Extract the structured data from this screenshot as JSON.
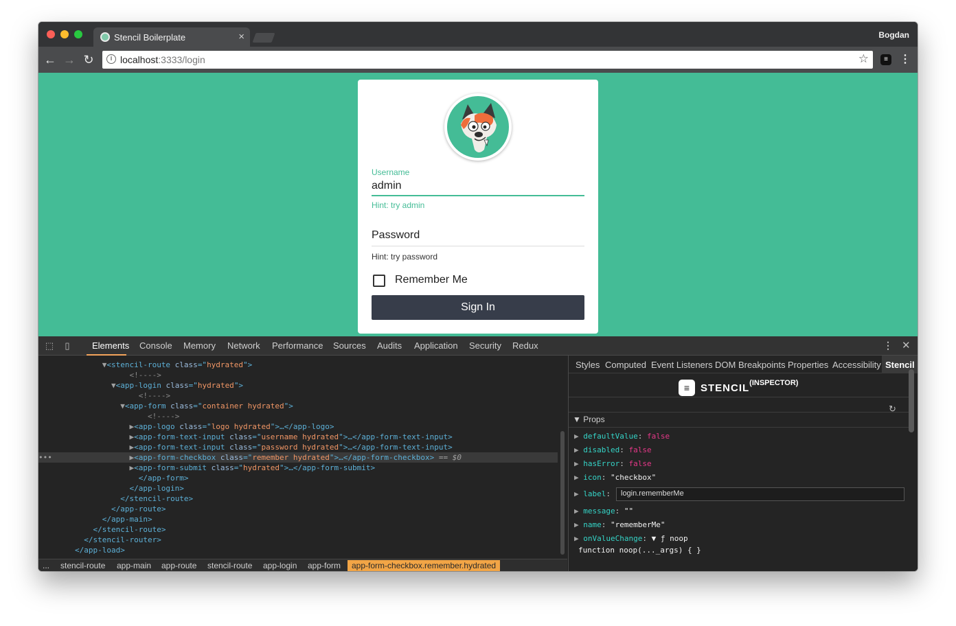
{
  "browser": {
    "tab_title": "Stencil Boilerplate",
    "tab_close": "×",
    "profile_name": "Bogdan",
    "url_host": "localhost",
    "url_path": ":3333/login"
  },
  "login": {
    "username_label": "Username",
    "username_value": "admin",
    "username_hint": "Hint: try admin",
    "password_placeholder": "Password",
    "password_hint": "Hint: try password",
    "remember_label": "Remember Me",
    "signin_label": "Sign In"
  },
  "colors": {
    "page_background": "#44bc96",
    "button": "#373d4a",
    "accent": "#44bc96",
    "breadcrumb_active": "#f2a546"
  },
  "devtools": {
    "tabs": [
      "Elements",
      "Console",
      "Memory",
      "Network",
      "Performance",
      "Sources",
      "Audits",
      "Application",
      "Security",
      "Redux"
    ],
    "active_tab": "Elements",
    "breadcrumbs": [
      "...",
      "stencil-route",
      "app-main",
      "app-route",
      "stencil-route",
      "app-login",
      "app-form",
      "app-form-checkbox.remember.hydrated"
    ],
    "sidebar_tabs": [
      "Styles",
      "Computed",
      "Event Listeners",
      "DOM Breakpoints",
      "Properties",
      "Accessibility",
      "Stencil"
    ],
    "sidebar_active_tab": "Stencil",
    "stencil_brand": "STENCIL",
    "stencil_brand_sup": "(INSPECTOR)",
    "props_header": "Props",
    "props": [
      {
        "key": "defaultValue",
        "value": "false",
        "kind": "bool"
      },
      {
        "key": "disabled",
        "value": "false",
        "kind": "bool"
      },
      {
        "key": "hasError",
        "value": "false",
        "kind": "bool"
      },
      {
        "key": "icon",
        "value": "\"checkbox\"",
        "kind": "string"
      },
      {
        "key": "label",
        "value": "login.rememberMe",
        "kind": "input"
      },
      {
        "key": "message",
        "value": "\"\"",
        "kind": "string"
      },
      {
        "key": "name",
        "value": "\"rememberMe\"",
        "kind": "string"
      },
      {
        "key": "onValueChange",
        "value": "▼ ƒ noop",
        "kind": "string"
      }
    ],
    "function_line": "function noop(..._args) { }"
  },
  "dom_tree": [
    {
      "indent": 7,
      "arrow": "▼",
      "open": "<",
      "tag": "stencil-route",
      "attr": "class",
      "val": "hydrated",
      "tail": ">"
    },
    {
      "indent": 9,
      "comment": "<!---->"
    },
    {
      "indent": 8,
      "arrow": "▼",
      "open": "<",
      "tag": "app-login",
      "attr": "class",
      "val": "hydrated",
      "tail": ">"
    },
    {
      "indent": 10,
      "comment": "<!---->"
    },
    {
      "indent": 9,
      "arrow": "▼",
      "open": "<",
      "tag": "app-form",
      "attr": "class",
      "val": "container hydrated",
      "tail": ">"
    },
    {
      "indent": 11,
      "comment": "<!---->"
    },
    {
      "indent": 10,
      "arrow": "▶",
      "open": "<",
      "tag": "app-logo",
      "attr": "class",
      "val": "logo hydrated",
      "tail": ">…</app-logo>"
    },
    {
      "indent": 10,
      "arrow": "▶",
      "open": "<",
      "tag": "app-form-text-input",
      "attr": "class",
      "val": "username hydrated",
      "tail": ">…</app-form-text-input>"
    },
    {
      "indent": 10,
      "arrow": "▶",
      "open": "<",
      "tag": "app-form-text-input",
      "attr": "class",
      "val": "password hydrated",
      "tail": ">…</app-form-text-input>"
    },
    {
      "indent": 10,
      "arrow": "▶",
      "open": "<",
      "tag": "app-form-checkbox",
      "attr": "class",
      "val": "remember hydrated",
      "tail": ">…</app-form-checkbox>",
      "selected": true,
      "suffix": " == $0"
    },
    {
      "indent": 10,
      "arrow": "▶",
      "open": "<",
      "tag": "app-form-submit",
      "attr": "class",
      "val": "hydrated",
      "tail": ">…</app-form-submit>"
    },
    {
      "indent": 10,
      "close": "</app-form>"
    },
    {
      "indent": 9,
      "close": "</app-login>"
    },
    {
      "indent": 8,
      "close": "</stencil-route>"
    },
    {
      "indent": 7,
      "close": "</app-route>"
    },
    {
      "indent": 6,
      "close": "</app-main>"
    },
    {
      "indent": 5,
      "close": "</stencil-route>"
    },
    {
      "indent": 4,
      "close": "</stencil-router>"
    },
    {
      "indent": 3,
      "close": "</app-load>"
    }
  ]
}
